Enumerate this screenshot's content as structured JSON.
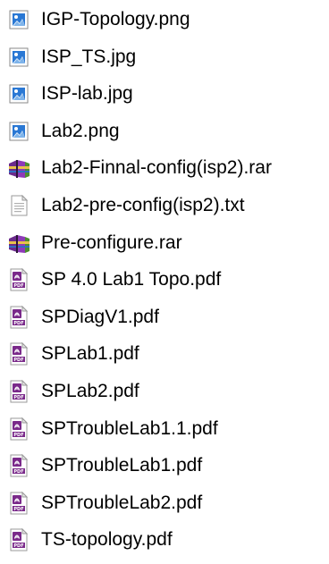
{
  "files": [
    {
      "name": "IGP-Topology.png",
      "icon": "image-file-icon"
    },
    {
      "name": "ISP_TS.jpg",
      "icon": "image-file-icon"
    },
    {
      "name": "ISP-lab.jpg",
      "icon": "image-file-icon"
    },
    {
      "name": "Lab2.png",
      "icon": "image-file-icon"
    },
    {
      "name": "Lab2-Finnal-config(isp2).rar",
      "icon": "rar-archive-icon"
    },
    {
      "name": "Lab2-pre-config(isp2).txt",
      "icon": "text-file-icon"
    },
    {
      "name": "Pre-configure.rar",
      "icon": "rar-archive-icon"
    },
    {
      "name": "SP 4.0 Lab1 Topo.pdf",
      "icon": "pdf-file-icon"
    },
    {
      "name": "SPDiagV1.pdf",
      "icon": "pdf-file-icon"
    },
    {
      "name": "SPLab1.pdf",
      "icon": "pdf-file-icon"
    },
    {
      "name": "SPLab2.pdf",
      "icon": "pdf-file-icon"
    },
    {
      "name": "SPTroubleLab1.1.pdf",
      "icon": "pdf-file-icon"
    },
    {
      "name": "SPTroubleLab1.pdf",
      "icon": "pdf-file-icon"
    },
    {
      "name": "SPTroubleLab2.pdf",
      "icon": "pdf-file-icon"
    },
    {
      "name": "TS-topology.pdf",
      "icon": "pdf-file-icon"
    }
  ]
}
